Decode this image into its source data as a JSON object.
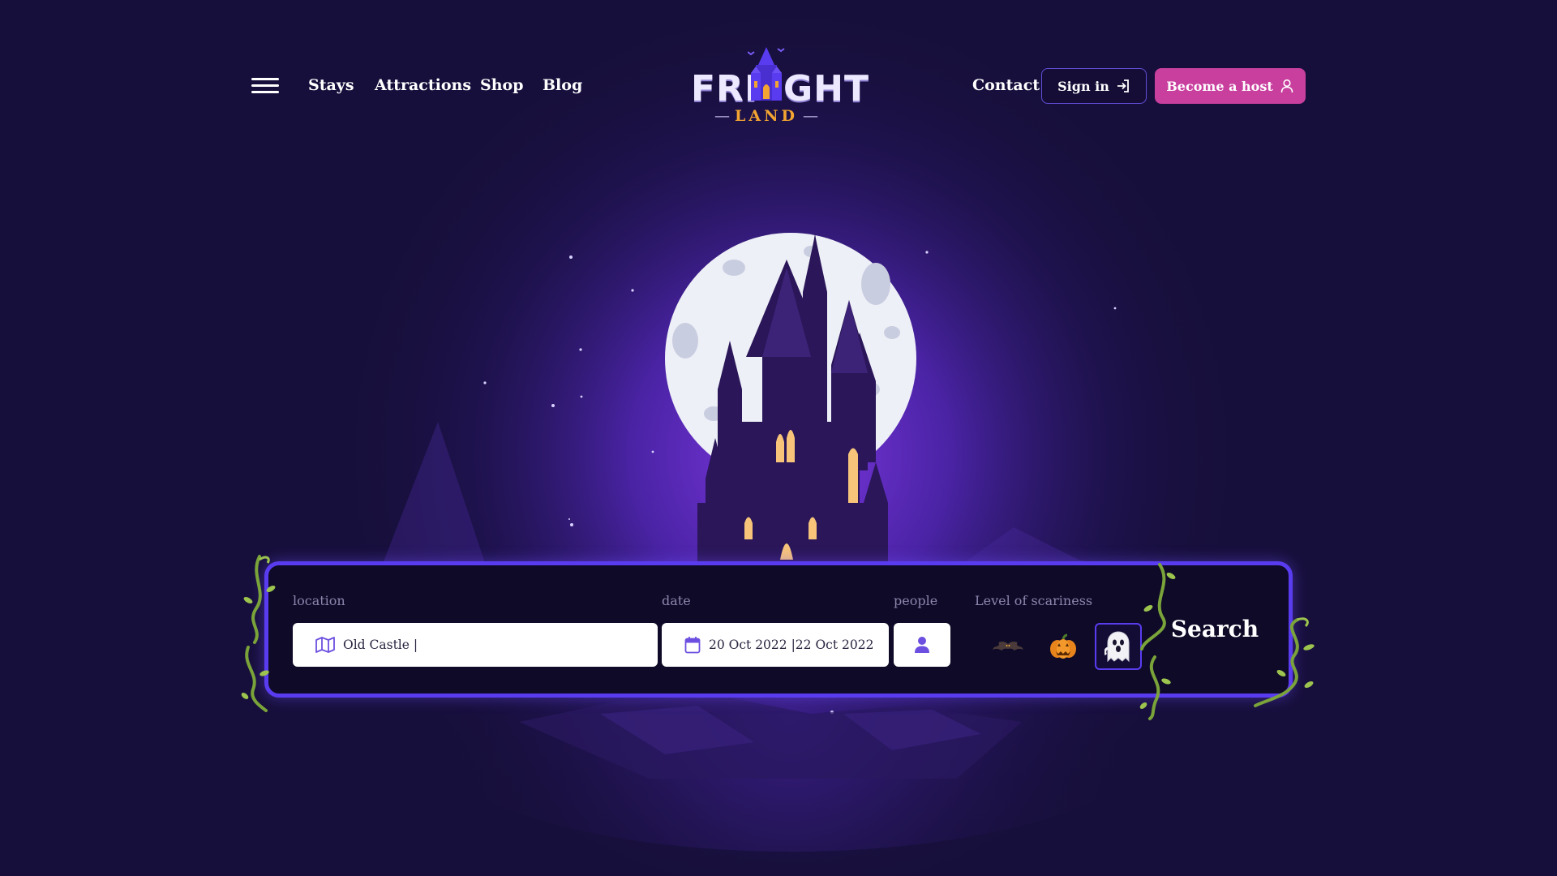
{
  "nav": {
    "menu_icon": "hamburger-menu-icon",
    "links": [
      "Stays",
      "Attractions",
      "Shop",
      "Blog"
    ],
    "contact": "Contact",
    "signin_label": "Sign in",
    "signin_icon": "sign-in-arrow-icon",
    "host_label": "Become a host",
    "host_icon": "user-icon"
  },
  "logo": {
    "word_left": "FRI",
    "word_right": "GHT",
    "sub": "LAND",
    "emblem_icon": "haunted-castle-icon"
  },
  "search": {
    "location_label": "location",
    "location_value": "Old Castle |",
    "location_icon": "map-icon",
    "date_label": "date",
    "date_value": "20 Oct 2022 |22 Oct 2022",
    "date_icon": "calendar-icon",
    "people_label": "people",
    "people_icon": "person-icon",
    "scariness_label": "Level of scariness",
    "scariness_options": [
      {
        "icon": "bat-icon",
        "selected": false
      },
      {
        "icon": "pumpkin-icon",
        "selected": false
      },
      {
        "icon": "ghost-icon",
        "selected": true
      }
    ],
    "search_label": "Search"
  },
  "colors": {
    "background": "#170f3b",
    "accent_purple": "#5a3cf0",
    "host_pink": "#c83f9e",
    "logo_orange": "#f3a531",
    "label_gray": "#8c86ad"
  }
}
